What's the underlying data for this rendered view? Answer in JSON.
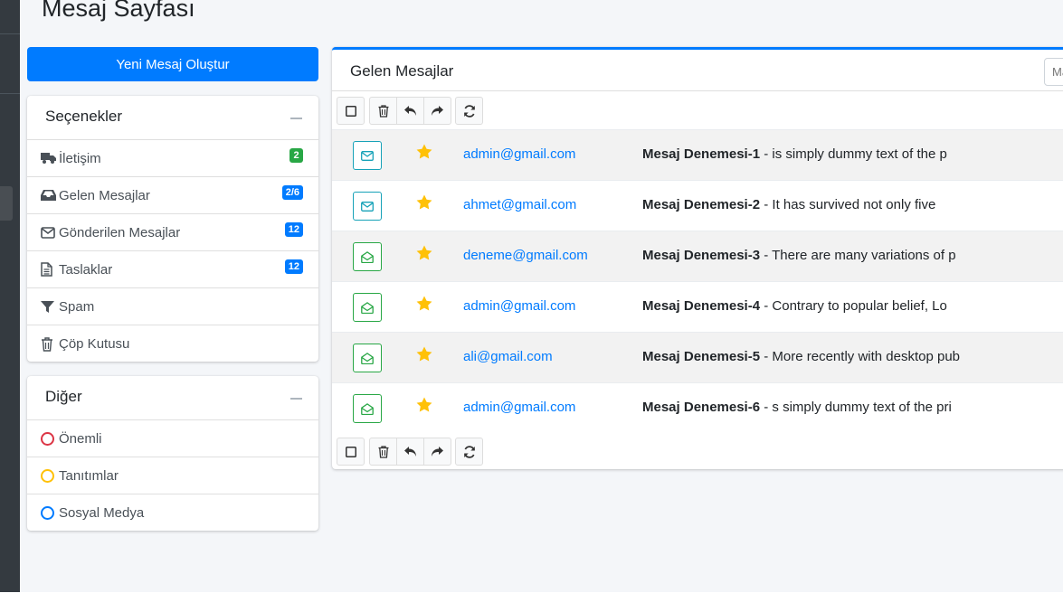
{
  "page": {
    "title": "Mesaj Sayfası"
  },
  "compose": {
    "label": "Yeni Mesaj Oluştur"
  },
  "options": {
    "title": "Seçenekler",
    "items": [
      {
        "label": "İletişim",
        "icon": "truck-icon",
        "badge": "2",
        "badge_color": "#28a745"
      },
      {
        "label": "Gelen Mesajlar",
        "icon": "inbox-icon",
        "badge": "2/6",
        "badge_color": "#007bff"
      },
      {
        "label": "Gönderilen Mesajlar",
        "icon": "envelope-icon",
        "badge": "12",
        "badge_color": "#007bff"
      },
      {
        "label": "Taslaklar",
        "icon": "file-icon",
        "badge": "12",
        "badge_color": "#007bff"
      },
      {
        "label": "Spam",
        "icon": "filter-icon",
        "badge": "",
        "badge_color": ""
      },
      {
        "label": "Çöp Kutusu",
        "icon": "trash-icon",
        "badge": "",
        "badge_color": ""
      }
    ]
  },
  "other": {
    "title": "Diğer",
    "items": [
      {
        "label": "Önemli",
        "color": "#dc3545"
      },
      {
        "label": "Tanıtımlar",
        "color": "#ffc107"
      },
      {
        "label": "Sosyal Medya",
        "color": "#007bff"
      }
    ]
  },
  "inbox": {
    "title": "Gelen Mesajlar",
    "search_placeholder": "Mail Ara",
    "messages": [
      {
        "sender": "admin@gmail.com",
        "subject": "Mesaj Denemesi-1",
        "preview": " - is simply dummy text of the p",
        "status": "unread"
      },
      {
        "sender": "ahmet@gmail.com",
        "subject": "Mesaj Denemesi-2",
        "preview": " - It has survived not only five",
        "status": "unread"
      },
      {
        "sender": "deneme@gmail.com",
        "subject": "Mesaj Denemesi-3",
        "preview": " - There are many variations of p",
        "status": "read"
      },
      {
        "sender": "admin@gmail.com",
        "subject": "Mesaj Denemesi-4",
        "preview": " - Contrary to popular belief, Lo",
        "status": "read"
      },
      {
        "sender": "ali@gmail.com",
        "subject": "Mesaj Denemesi-5",
        "preview": " - More recently with desktop pub",
        "status": "read"
      },
      {
        "sender": "admin@gmail.com",
        "subject": "Mesaj Denemesi-6",
        "preview": " - s simply dummy text of the pri",
        "status": "read"
      }
    ]
  },
  "colors": {
    "primary": "#007bff",
    "star": "#ffc107",
    "info": "#17a2b8",
    "success": "#28a745"
  }
}
